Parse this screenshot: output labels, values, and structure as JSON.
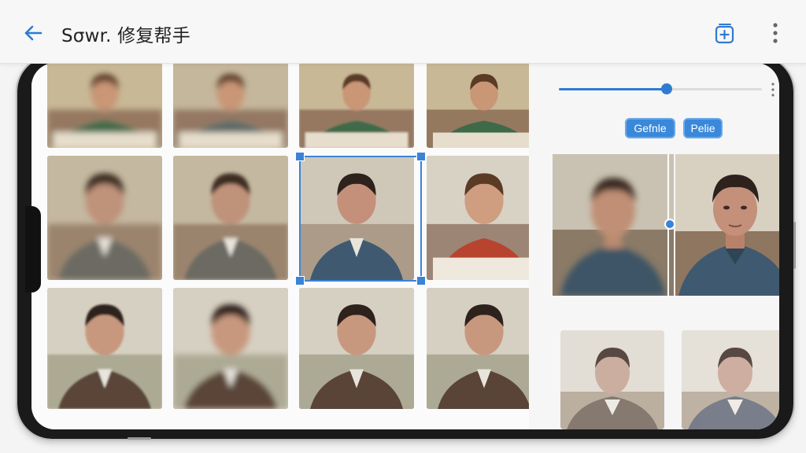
{
  "header": {
    "title": "Sσwr. 修复帮手",
    "back_icon": "arrow-left-icon",
    "add_icon": "add-frame-icon",
    "more_icon": "more-vertical-icon"
  },
  "grid": {
    "selected_index": 6,
    "tiles": [
      {
        "kind": "boy-green",
        "blur": "strong"
      },
      {
        "kind": "boy-grey",
        "blur": "strong"
      },
      {
        "kind": "boy-green",
        "blur": "light"
      },
      {
        "kind": "boy-green",
        "blur": "none"
      },
      {
        "kind": "man-grey",
        "blur": "strong"
      },
      {
        "kind": "man-grey",
        "blur": "medium"
      },
      {
        "kind": "man-blue",
        "blur": "none"
      },
      {
        "kind": "boy-red",
        "blur": "none"
      },
      {
        "kind": "man-brown",
        "blur": "light"
      },
      {
        "kind": "man-brown",
        "blur": "strong"
      },
      {
        "kind": "man-brown",
        "blur": "none"
      },
      {
        "kind": "man-brown",
        "blur": "none"
      }
    ]
  },
  "panel": {
    "slider_value": 0.53,
    "chips": [
      "Gefnle",
      "Pelie"
    ],
    "compare_split": 0.5,
    "more_icon": "more-vertical-icon"
  },
  "colors": {
    "accent": "#3b83d6",
    "chip_bg": "#3a88d9"
  }
}
